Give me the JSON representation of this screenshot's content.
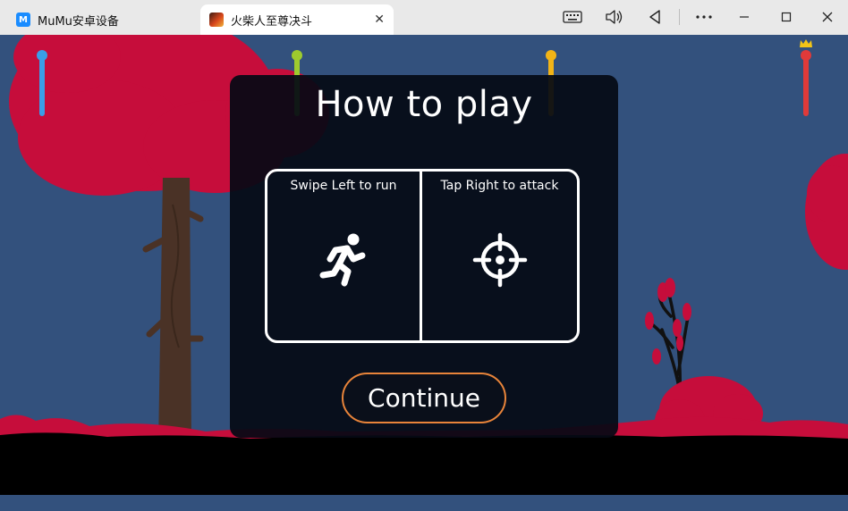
{
  "window": {
    "tabs": [
      {
        "label": "MuMu安卓设备",
        "icon": "mumu-logo-icon",
        "active": false
      },
      {
        "label": "火柴人至尊决斗",
        "icon": "game-icon",
        "active": true
      }
    ],
    "tab_close_glyph": "✕",
    "controls": {
      "keyboard": "keyboard-icon",
      "volume": "volume-icon",
      "back": "back-icon",
      "more": "more-icon",
      "minimize": "minimize-icon",
      "maximize": "maximize-icon",
      "close": "close-icon"
    }
  },
  "game": {
    "players": [
      {
        "color": "#3a9ee8",
        "name": "blue-player"
      },
      {
        "color": "#9ecb2e",
        "name": "green-player"
      },
      {
        "color": "#f2b417",
        "name": "yellow-player"
      },
      {
        "color": "#e03a3a",
        "name": "red-player",
        "crown": true
      }
    ],
    "colors": {
      "sky": "#33517d",
      "foliage": "#c60d3b",
      "trunk": "#4a3226",
      "ground": "#000000",
      "accent": "#e8843a"
    }
  },
  "dialog": {
    "title": "How to play",
    "left_panel": {
      "label": "Swipe Left to run",
      "icon": "running-person-icon"
    },
    "right_panel": {
      "label": "Tap Right to attack",
      "icon": "crosshair-icon"
    },
    "continue_label": "Continue"
  }
}
